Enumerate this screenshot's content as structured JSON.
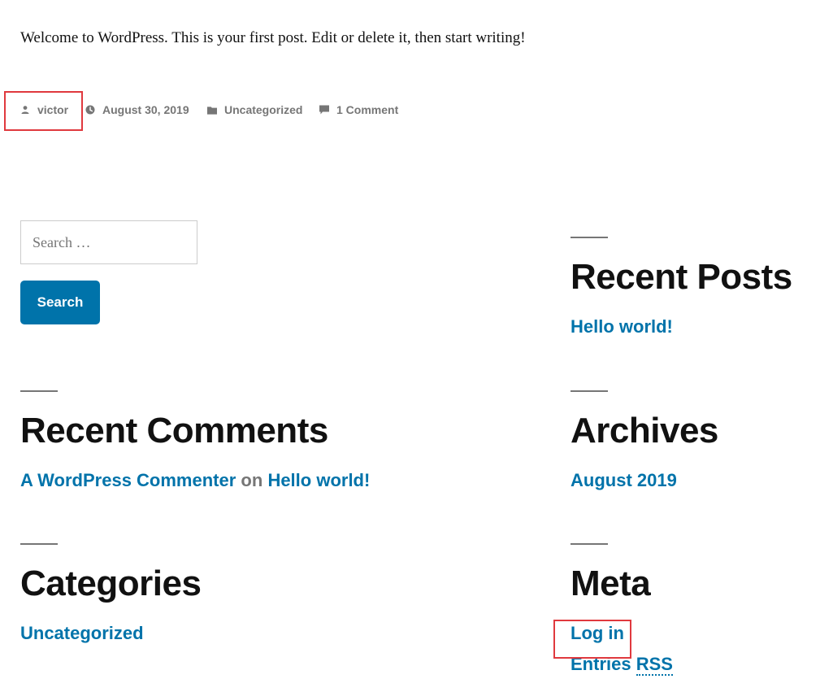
{
  "post": {
    "content": "Welcome to WordPress. This is your first post. Edit or delete it, then start writing!",
    "meta": {
      "author": "victor",
      "date": "August 30, 2019",
      "category": "Uncategorized",
      "comments": "1 Comment",
      "icons": [
        "person-icon",
        "clock-icon",
        "folder-icon",
        "comment-icon"
      ]
    }
  },
  "search": {
    "placeholder": "Search …",
    "button_label": "Search"
  },
  "widgets": {
    "recent_posts": {
      "title": "Recent Posts",
      "items": [
        "Hello world!"
      ]
    },
    "recent_comments": {
      "title": "Recent Comments",
      "author": "A WordPress Commenter",
      "connector": "on",
      "post": "Hello world!"
    },
    "archives": {
      "title": "Archives",
      "items": [
        "August 2019"
      ]
    },
    "categories": {
      "title": "Categories",
      "items": [
        "Uncategorized"
      ]
    },
    "meta": {
      "title": "Meta",
      "login": "Log in",
      "entries_prefix": "Entries",
      "entries_rss": "RSS"
    }
  },
  "colors": {
    "link": "#0073aa",
    "meta_text": "#767676",
    "heading": "#111111",
    "highlight": "#e0393e"
  }
}
